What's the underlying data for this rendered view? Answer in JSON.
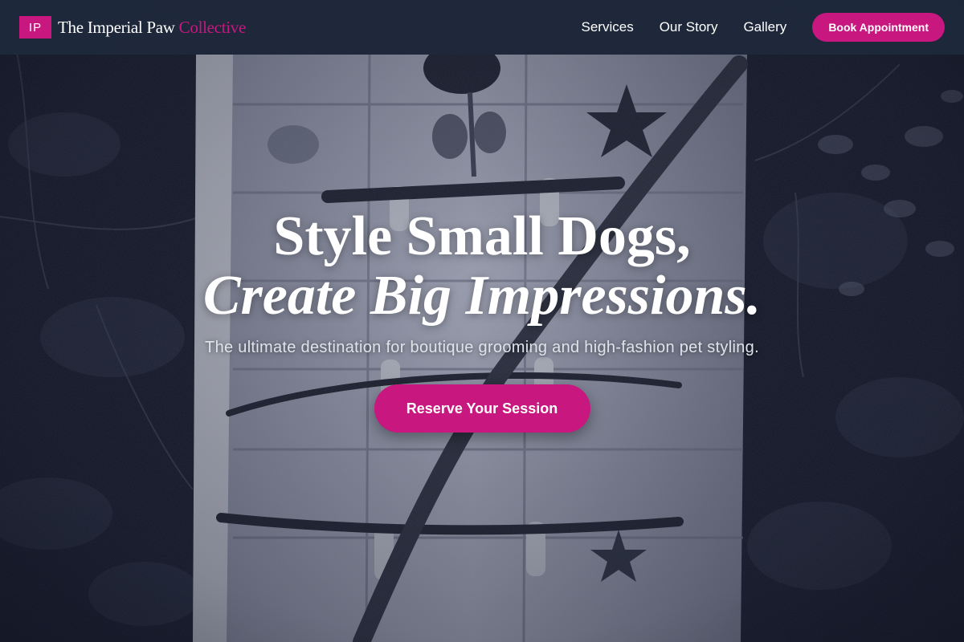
{
  "brand": {
    "logo_initials": "IP",
    "name": "The Imperial Paw",
    "accent_word": "Collective"
  },
  "nav": {
    "items": [
      {
        "label": "Services"
      },
      {
        "label": "Our Story"
      },
      {
        "label": "Gallery"
      }
    ],
    "cta_label": "Book Appointment"
  },
  "hero": {
    "headline_line1": "Style Small Dogs,",
    "headline_line2": "Create Big Impressions.",
    "subtitle": "The ultimate destination for boutique grooming and high-fashion pet styling.",
    "cta_label": "Reserve Your Session"
  },
  "colors": {
    "accent": "#c8177f",
    "navbar": "#1e293b",
    "text": "#ffffff"
  },
  "icons": {
    "background_image": "painted-birdhouse-with-sticks-photo"
  }
}
